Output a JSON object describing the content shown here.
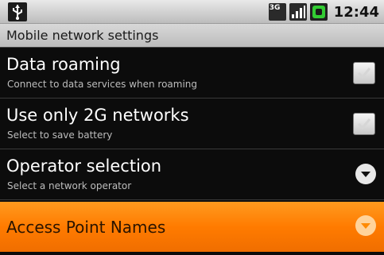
{
  "statusbar": {
    "usb_icon": "usb-debugging-icon",
    "network_badge": "3G",
    "signal_icon": "signal-bars-icon",
    "battery_icon": "battery-charging-icon",
    "time": "12:44"
  },
  "titlebar": {
    "title": "Mobile network settings"
  },
  "prefs": [
    {
      "title": "Data roaming",
      "summary": "Connect to data services when roaming",
      "widget": "checkbox",
      "checked": false
    },
    {
      "title": "Use only 2G networks",
      "summary": "Select to save battery",
      "widget": "checkbox",
      "checked": false
    },
    {
      "title": "Operator selection",
      "summary": "Select a network operator",
      "widget": "chevron-down-icon"
    },
    {
      "title": "Access Point Names",
      "summary": "",
      "widget": "chevron-down-icon",
      "selected": true
    }
  ],
  "colors": {
    "highlight": "#ff8a00",
    "background": "#0c0c0c",
    "title_text": "#ffffff",
    "summary_text": "#bdbdbd"
  }
}
